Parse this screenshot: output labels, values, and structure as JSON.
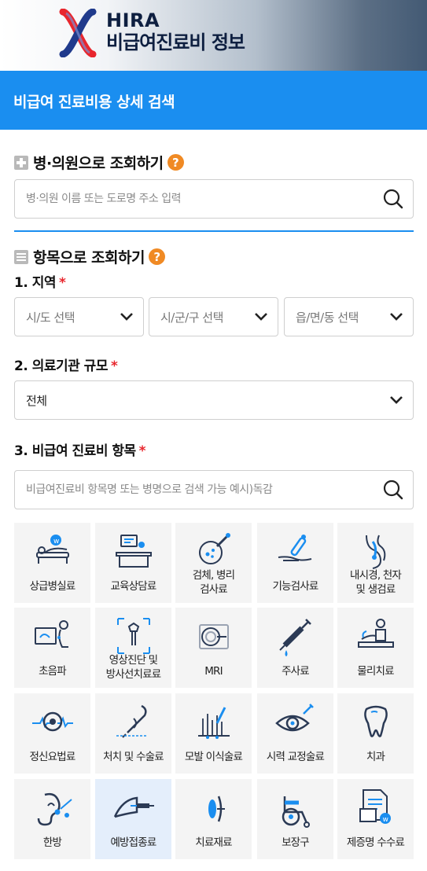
{
  "header": {
    "brand_en": "HIRA",
    "brand_ko": "비급여진료비 정보"
  },
  "banner": {
    "title": "비급여 진료비용 상세 검색"
  },
  "hospital_search": {
    "title": "병·의원으로 조회하기",
    "help": "?",
    "placeholder": "병·의원 이름 또는 도로명 주소 입력"
  },
  "item_search": {
    "title": "항목으로 조회하기",
    "help": "?",
    "region": {
      "label": "1. 지역",
      "required": "*",
      "selects": [
        "시/도 선택",
        "시/군/구 선택",
        "읍/면/동 선택"
      ]
    },
    "scale": {
      "label": "2. 의료기관 규모",
      "required": "*",
      "value": "전체"
    },
    "items": {
      "label": "3. 비급여 진료비 항목",
      "required": "*",
      "placeholder": "비급여진료비 항목명 또는 병명으로 검색 가능 예시)독감"
    }
  },
  "categories": [
    {
      "line1": "상급병실료",
      "line2": "",
      "icon": "hospital-bed-icon"
    },
    {
      "line1": "교육상담료",
      "line2": "",
      "icon": "counseling-icon"
    },
    {
      "line1": "검체, 병리",
      "line2": "검사료",
      "icon": "specimen-test-icon"
    },
    {
      "line1": "기능검사료",
      "line2": "",
      "icon": "function-test-icon"
    },
    {
      "line1": "내시경, 천자",
      "line2": "및 생검료",
      "icon": "endoscope-icon"
    },
    {
      "line1": "초음파",
      "line2": "",
      "icon": "ultrasound-icon"
    },
    {
      "line1": "영상진단 및",
      "line2": "방사선치료료",
      "icon": "imaging-icon"
    },
    {
      "line1": "MRI",
      "line2": "",
      "icon": "mri-icon"
    },
    {
      "line1": "주사료",
      "line2": "",
      "icon": "injection-icon"
    },
    {
      "line1": "물리치료",
      "line2": "",
      "icon": "physical-therapy-icon"
    },
    {
      "line1": "정신요법료",
      "line2": "",
      "icon": "psychotherapy-icon"
    },
    {
      "line1": "처치 및 수술료",
      "line2": "",
      "icon": "surgery-icon"
    },
    {
      "line1": "모발 이식술료",
      "line2": "",
      "icon": "hair-transplant-icon"
    },
    {
      "line1": "시력 교정술료",
      "line2": "",
      "icon": "vision-correction-icon"
    },
    {
      "line1": "치과",
      "line2": "",
      "icon": "tooth-icon"
    },
    {
      "line1": "한방",
      "line2": "",
      "icon": "acupuncture-icon"
    },
    {
      "line1": "예방접종료",
      "line2": "",
      "icon": "vaccination-icon"
    },
    {
      "line1": "치료재료",
      "line2": "",
      "icon": "treatment-material-icon"
    },
    {
      "line1": "보장구",
      "line2": "",
      "icon": "wheelchair-icon"
    },
    {
      "line1": "제증명 수수료",
      "line2": "",
      "icon": "certificate-icon"
    }
  ],
  "colors": {
    "primary": "#1a8ef0",
    "help": "#f08a24",
    "required": "#e8262d",
    "tile_bg": "#f4f4f4",
    "tile_active_bg": "#e4eefb"
  }
}
